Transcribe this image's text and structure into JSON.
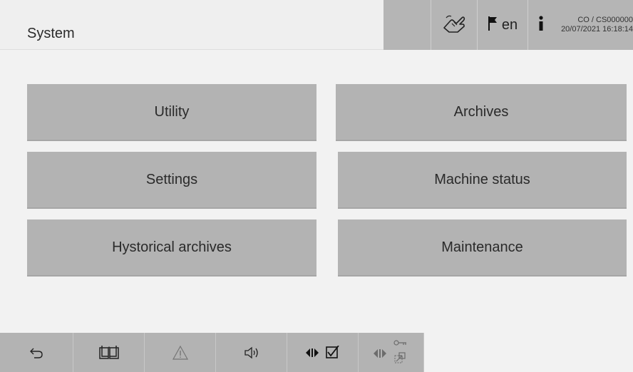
{
  "header": {
    "title": "System",
    "language": "en",
    "user_line1": "CO / CS000000",
    "user_line2": "20/07/2021 16:18:14",
    "icons": [
      "hand-touch-icon",
      "flag-icon",
      "info-icon"
    ]
  },
  "menu": {
    "utility": "Utility",
    "archives": "Archives",
    "settings": "Settings",
    "machine_status": "Machine status",
    "hystorical_archives": "Hystorical archives",
    "maintenance": "Maintenance"
  },
  "footer": {
    "icons": [
      "back-arrow-icon",
      "manual-book-icon",
      "warning-icon",
      "speaker-icon",
      "play-check-icon",
      "play-key-icon"
    ],
    "disabled": [
      "warning-icon",
      "play-key-icon"
    ]
  },
  "colors": {
    "button": "#b3b3b3",
    "background": "#f2f2f2",
    "text": "#2a2a2a"
  }
}
